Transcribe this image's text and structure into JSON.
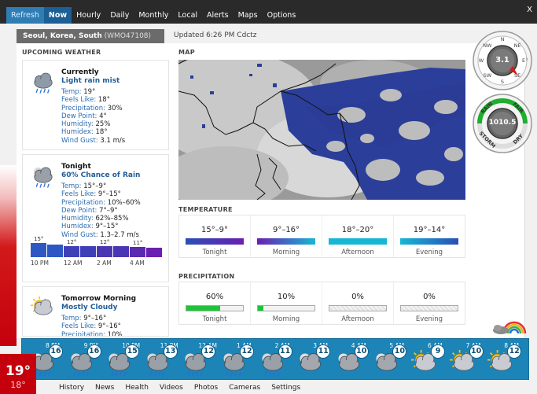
{
  "topnav": {
    "tabs": [
      "Refresh",
      "Now",
      "Hourly",
      "Daily",
      "Monthly",
      "Local",
      "Alerts",
      "Maps",
      "Options"
    ],
    "active": "Now",
    "close_label": "X"
  },
  "location": {
    "name": "Seoul, Korea, South",
    "code": "(WMO47108)",
    "updated": "Updated 6:26 PM Cdctz"
  },
  "sections": {
    "upcoming": "UPCOMING WEATHER",
    "map": "MAP",
    "temperature": "TEMPERATURE",
    "precipitation": "PRECIPITATION"
  },
  "forecasts": [
    {
      "title": "Currently",
      "condition": "Light rain mist",
      "icon": "light-rain-icon",
      "rows": [
        {
          "label": "Temp:",
          "value": "19°"
        },
        {
          "label": "Feels Like:",
          "value": "18°"
        },
        {
          "label": "Precipitation:",
          "value": "30%"
        },
        {
          "label": "Dew Point:",
          "value": "4°"
        },
        {
          "label": "Humidity:",
          "value": "25%"
        },
        {
          "label": "Humidex:",
          "value": "18°"
        },
        {
          "label": "Wind Gust:",
          "value": "3.1 m/s"
        }
      ]
    },
    {
      "title": "Tonight",
      "condition": "60% Chance of Rain",
      "icon": "rain-night-icon",
      "rows": [
        {
          "label": "Temp:",
          "value": "15°–9°"
        },
        {
          "label": "Feels Like:",
          "value": "9°–15°"
        },
        {
          "label": "Precipitation:",
          "value": "10%–60%"
        },
        {
          "label": "Dew Point:",
          "value": "7°–9°"
        },
        {
          "label": "Humidity:",
          "value": "62%–85%"
        },
        {
          "label": "Humidex:",
          "value": "9°–15°"
        },
        {
          "label": "Wind Gust:",
          "value": "1.3–2.7 m/s"
        }
      ],
      "chart": {
        "labels": [
          "15°",
          "12°",
          "12°",
          "11°"
        ],
        "values": [
          15,
          13,
          12,
          12,
          12,
          12,
          11,
          10
        ],
        "times": [
          "10 PM",
          "12 AM",
          "2 AM",
          "4 AM"
        ]
      }
    },
    {
      "title": "Tomorrow Morning",
      "condition": "Mostly Cloudy",
      "icon": "mostly-cloudy-icon",
      "rows": [
        {
          "label": "Temp:",
          "value": "9°–16°"
        },
        {
          "label": "Feels Like:",
          "value": "9°–16°"
        },
        {
          "label": "Precipitation:",
          "value": "10%"
        }
      ]
    }
  ],
  "temperature": [
    {
      "value": "15°–9°",
      "label": "Tonight",
      "color": "#2a4fb5",
      "color2": "#6a1fb0"
    },
    {
      "value": "9°–16°",
      "label": "Morning",
      "color": "#6a1fb0",
      "color2": "#17b7d4"
    },
    {
      "value": "18°–20°",
      "label": "Afternoon",
      "color": "#17b7d4",
      "color2": "#17b7d4"
    },
    {
      "value": "19°–14°",
      "label": "Evening",
      "color": "#17b7d4",
      "color2": "#2a4fb5"
    }
  ],
  "precipitation": [
    {
      "value": "60%",
      "label": "Tonight",
      "percent": 60
    },
    {
      "value": "10%",
      "label": "Morning",
      "percent": 10
    },
    {
      "value": "0%",
      "label": "Afternoon",
      "percent": 0
    },
    {
      "value": "0%",
      "label": "Evening",
      "percent": 0
    }
  ],
  "wind": {
    "value": "3.1",
    "labels": [
      "N",
      "NE",
      "E",
      "SE",
      "S",
      "SW",
      "W",
      "NW"
    ]
  },
  "pressure": {
    "value": "1010.5",
    "labels": [
      "RAIN",
      "FAIR",
      "DRY",
      "STORM"
    ]
  },
  "current": {
    "temp": "19°",
    "feels": "18°"
  },
  "hourly": [
    {
      "time": "8 PM",
      "temp": "16",
      "icon": "rain-icon"
    },
    {
      "time": "9 PM",
      "temp": "16",
      "icon": "rain-icon"
    },
    {
      "time": "10 PM",
      "temp": "15",
      "icon": "rain-icon"
    },
    {
      "time": "11 PM",
      "temp": "13",
      "icon": "rain-icon"
    },
    {
      "time": "12 AM",
      "temp": "12",
      "icon": "rain-icon"
    },
    {
      "time": "1 AM",
      "temp": "12",
      "icon": "rain-icon"
    },
    {
      "time": "2 AM",
      "temp": "11",
      "icon": "rain-icon"
    },
    {
      "time": "3 AM",
      "temp": "11",
      "icon": "cloudy-night-icon"
    },
    {
      "time": "4 AM",
      "temp": "10",
      "icon": "cloudy-night-icon"
    },
    {
      "time": "5 AM",
      "temp": "10",
      "icon": "cloudy-night-icon"
    },
    {
      "time": "6 AM",
      "temp": "9",
      "icon": "partly-sunny-icon"
    },
    {
      "time": "7 AM",
      "temp": "10",
      "icon": "partly-sunny-icon"
    },
    {
      "time": "8 AM",
      "temp": "12",
      "icon": "partly-sunny-icon"
    }
  ],
  "bottomnav": [
    "History",
    "News",
    "Health",
    "Videos",
    "Photos",
    "Cameras",
    "Settings"
  ]
}
